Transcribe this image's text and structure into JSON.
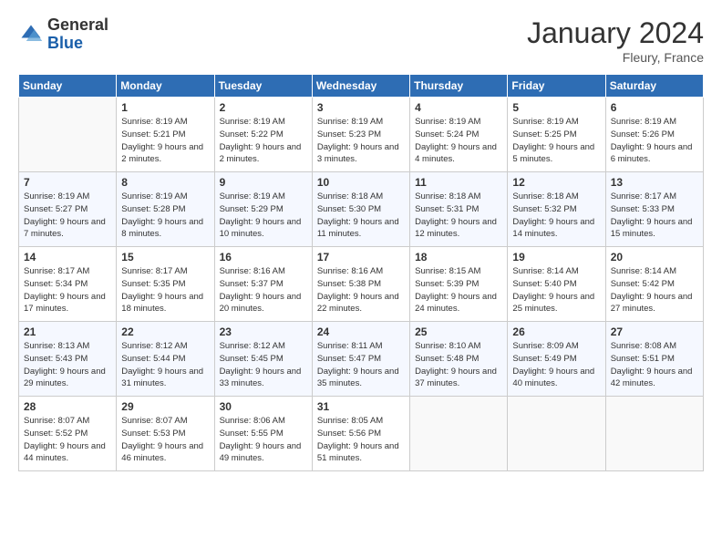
{
  "header": {
    "logo_general": "General",
    "logo_blue": "Blue",
    "title": "January 2024",
    "subtitle": "Fleury, France"
  },
  "days_of_week": [
    "Sunday",
    "Monday",
    "Tuesday",
    "Wednesday",
    "Thursday",
    "Friday",
    "Saturday"
  ],
  "weeks": [
    [
      {
        "day": "",
        "sunrise": "",
        "sunset": "",
        "daylight": ""
      },
      {
        "day": "1",
        "sunrise": "Sunrise: 8:19 AM",
        "sunset": "Sunset: 5:21 PM",
        "daylight": "Daylight: 9 hours and 2 minutes."
      },
      {
        "day": "2",
        "sunrise": "Sunrise: 8:19 AM",
        "sunset": "Sunset: 5:22 PM",
        "daylight": "Daylight: 9 hours and 2 minutes."
      },
      {
        "day": "3",
        "sunrise": "Sunrise: 8:19 AM",
        "sunset": "Sunset: 5:23 PM",
        "daylight": "Daylight: 9 hours and 3 minutes."
      },
      {
        "day": "4",
        "sunrise": "Sunrise: 8:19 AM",
        "sunset": "Sunset: 5:24 PM",
        "daylight": "Daylight: 9 hours and 4 minutes."
      },
      {
        "day": "5",
        "sunrise": "Sunrise: 8:19 AM",
        "sunset": "Sunset: 5:25 PM",
        "daylight": "Daylight: 9 hours and 5 minutes."
      },
      {
        "day": "6",
        "sunrise": "Sunrise: 8:19 AM",
        "sunset": "Sunset: 5:26 PM",
        "daylight": "Daylight: 9 hours and 6 minutes."
      }
    ],
    [
      {
        "day": "7",
        "sunrise": "Sunrise: 8:19 AM",
        "sunset": "Sunset: 5:27 PM",
        "daylight": "Daylight: 9 hours and 7 minutes."
      },
      {
        "day": "8",
        "sunrise": "Sunrise: 8:19 AM",
        "sunset": "Sunset: 5:28 PM",
        "daylight": "Daylight: 9 hours and 8 minutes."
      },
      {
        "day": "9",
        "sunrise": "Sunrise: 8:19 AM",
        "sunset": "Sunset: 5:29 PM",
        "daylight": "Daylight: 9 hours and 10 minutes."
      },
      {
        "day": "10",
        "sunrise": "Sunrise: 8:18 AM",
        "sunset": "Sunset: 5:30 PM",
        "daylight": "Daylight: 9 hours and 11 minutes."
      },
      {
        "day": "11",
        "sunrise": "Sunrise: 8:18 AM",
        "sunset": "Sunset: 5:31 PM",
        "daylight": "Daylight: 9 hours and 12 minutes."
      },
      {
        "day": "12",
        "sunrise": "Sunrise: 8:18 AM",
        "sunset": "Sunset: 5:32 PM",
        "daylight": "Daylight: 9 hours and 14 minutes."
      },
      {
        "day": "13",
        "sunrise": "Sunrise: 8:17 AM",
        "sunset": "Sunset: 5:33 PM",
        "daylight": "Daylight: 9 hours and 15 minutes."
      }
    ],
    [
      {
        "day": "14",
        "sunrise": "Sunrise: 8:17 AM",
        "sunset": "Sunset: 5:34 PM",
        "daylight": "Daylight: 9 hours and 17 minutes."
      },
      {
        "day": "15",
        "sunrise": "Sunrise: 8:17 AM",
        "sunset": "Sunset: 5:35 PM",
        "daylight": "Daylight: 9 hours and 18 minutes."
      },
      {
        "day": "16",
        "sunrise": "Sunrise: 8:16 AM",
        "sunset": "Sunset: 5:37 PM",
        "daylight": "Daylight: 9 hours and 20 minutes."
      },
      {
        "day": "17",
        "sunrise": "Sunrise: 8:16 AM",
        "sunset": "Sunset: 5:38 PM",
        "daylight": "Daylight: 9 hours and 22 minutes."
      },
      {
        "day": "18",
        "sunrise": "Sunrise: 8:15 AM",
        "sunset": "Sunset: 5:39 PM",
        "daylight": "Daylight: 9 hours and 24 minutes."
      },
      {
        "day": "19",
        "sunrise": "Sunrise: 8:14 AM",
        "sunset": "Sunset: 5:40 PM",
        "daylight": "Daylight: 9 hours and 25 minutes."
      },
      {
        "day": "20",
        "sunrise": "Sunrise: 8:14 AM",
        "sunset": "Sunset: 5:42 PM",
        "daylight": "Daylight: 9 hours and 27 minutes."
      }
    ],
    [
      {
        "day": "21",
        "sunrise": "Sunrise: 8:13 AM",
        "sunset": "Sunset: 5:43 PM",
        "daylight": "Daylight: 9 hours and 29 minutes."
      },
      {
        "day": "22",
        "sunrise": "Sunrise: 8:12 AM",
        "sunset": "Sunset: 5:44 PM",
        "daylight": "Daylight: 9 hours and 31 minutes."
      },
      {
        "day": "23",
        "sunrise": "Sunrise: 8:12 AM",
        "sunset": "Sunset: 5:45 PM",
        "daylight": "Daylight: 9 hours and 33 minutes."
      },
      {
        "day": "24",
        "sunrise": "Sunrise: 8:11 AM",
        "sunset": "Sunset: 5:47 PM",
        "daylight": "Daylight: 9 hours and 35 minutes."
      },
      {
        "day": "25",
        "sunrise": "Sunrise: 8:10 AM",
        "sunset": "Sunset: 5:48 PM",
        "daylight": "Daylight: 9 hours and 37 minutes."
      },
      {
        "day": "26",
        "sunrise": "Sunrise: 8:09 AM",
        "sunset": "Sunset: 5:49 PM",
        "daylight": "Daylight: 9 hours and 40 minutes."
      },
      {
        "day": "27",
        "sunrise": "Sunrise: 8:08 AM",
        "sunset": "Sunset: 5:51 PM",
        "daylight": "Daylight: 9 hours and 42 minutes."
      }
    ],
    [
      {
        "day": "28",
        "sunrise": "Sunrise: 8:07 AM",
        "sunset": "Sunset: 5:52 PM",
        "daylight": "Daylight: 9 hours and 44 minutes."
      },
      {
        "day": "29",
        "sunrise": "Sunrise: 8:07 AM",
        "sunset": "Sunset: 5:53 PM",
        "daylight": "Daylight: 9 hours and 46 minutes."
      },
      {
        "day": "30",
        "sunrise": "Sunrise: 8:06 AM",
        "sunset": "Sunset: 5:55 PM",
        "daylight": "Daylight: 9 hours and 49 minutes."
      },
      {
        "day": "31",
        "sunrise": "Sunrise: 8:05 AM",
        "sunset": "Sunset: 5:56 PM",
        "daylight": "Daylight: 9 hours and 51 minutes."
      },
      {
        "day": "",
        "sunrise": "",
        "sunset": "",
        "daylight": ""
      },
      {
        "day": "",
        "sunrise": "",
        "sunset": "",
        "daylight": ""
      },
      {
        "day": "",
        "sunrise": "",
        "sunset": "",
        "daylight": ""
      }
    ]
  ]
}
